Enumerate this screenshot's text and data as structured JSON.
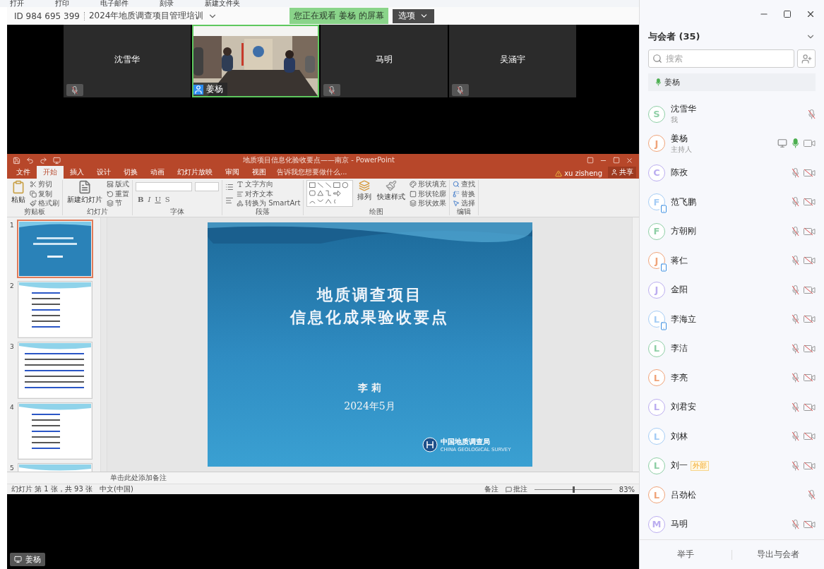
{
  "background_window": {
    "toolbar": [
      "打开",
      "打印",
      "电子邮件",
      "刻录",
      "新建文件夹"
    ]
  },
  "meeting": {
    "id": "ID 984 695 399",
    "title": "2024年地质调查项目管理培训",
    "banner": "您正在观看 姜杨 的屏幕",
    "options_button": "选项"
  },
  "video_tiles": [
    {
      "kind": "name",
      "name": "沈雪华",
      "muted": true
    },
    {
      "kind": "video",
      "name": "姜杨",
      "muted": false
    },
    {
      "kind": "name",
      "name": "马明",
      "muted": true
    },
    {
      "kind": "name",
      "name": "吴涵宇",
      "muted": true
    }
  ],
  "shared_screen": {
    "presenter_badge": "姜杨",
    "powerpoint": {
      "title": "地质项目信息化验收要点——南京 - PowerPoint",
      "tabs": [
        {
          "label": "文件",
          "selected": false
        },
        {
          "label": "开始",
          "selected": true
        },
        {
          "label": "插入",
          "selected": false
        },
        {
          "label": "设计",
          "selected": false
        },
        {
          "label": "切换",
          "selected": false
        },
        {
          "label": "动画",
          "selected": false
        },
        {
          "label": "幻灯片放映",
          "selected": false
        },
        {
          "label": "审阅",
          "selected": false
        },
        {
          "label": "视图",
          "selected": false
        }
      ],
      "tell_me": "告诉我您想要做什么...",
      "user": "xu zisheng",
      "share_button": "共享",
      "ribbon": {
        "clipboard": {
          "paste": "粘贴",
          "items": [
            "剪切",
            "复制",
            "格式刷"
          ],
          "label": "剪贴板"
        },
        "slides": {
          "new_slide": "新建幻灯片",
          "items": [
            "版式",
            "重置",
            "节"
          ],
          "label": "幻灯片"
        },
        "font": {
          "buttons": [
            "B",
            "I",
            "U",
            "S"
          ],
          "label": "字体"
        },
        "paragraph": {
          "items": [
            "文字方向",
            "对齐文本",
            "转换为 SmartArt"
          ],
          "label": "段落"
        },
        "drawing": {
          "arrange": "排列",
          "quick_styles": "快速样式",
          "items": [
            "形状填充",
            "形状轮廓",
            "形状效果"
          ],
          "label": "绘图"
        },
        "editing": {
          "items": [
            "查找",
            "替换",
            "选择"
          ],
          "label": "编辑"
        }
      },
      "thumbnails": [
        {
          "number": "1",
          "kind": "title",
          "selected": true
        },
        {
          "number": "2",
          "kind": "text",
          "selected": false
        },
        {
          "number": "3",
          "kind": "text",
          "selected": false
        },
        {
          "number": "4",
          "kind": "text",
          "selected": false
        },
        {
          "number": "5",
          "kind": "text",
          "selected": false
        }
      ],
      "slide": {
        "title_lines": [
          "地质调查项目",
          "信息化成果验收要点"
        ],
        "author": "李 莉",
        "date": "2024年5月",
        "logo_name": "中国地质调查局",
        "logo_english": "CHINA GEOLOGICAL SURVEY"
      },
      "notes_placeholder": "单击此处添加备注",
      "status_bar": {
        "slide_count": "幻灯片 第 1 张，共 93 张",
        "language": "中文(中国)",
        "notes": "备注",
        "comments": "批注",
        "zoom_slider": {
          "level": 0.5
        },
        "zoom": "83%"
      }
    }
  },
  "participants_panel": {
    "title": "与会者 (35)",
    "search": {
      "placeholder": "搜索"
    },
    "speaking": "姜杨",
    "participants": [
      {
        "name": "沈雪华",
        "subtitle": "我",
        "initial": "S",
        "color": "#8fcfa6",
        "muted": true,
        "mobile": false,
        "sharing": false
      },
      {
        "name": "姜杨",
        "subtitle": "主持人",
        "initial": "J",
        "color": "#f0a47a",
        "muted": false,
        "camera_off": false,
        "mobile": false,
        "sharing": true
      },
      {
        "name": "陈孜",
        "initial": "C",
        "color": "#bcaef0",
        "muted": true,
        "camera_off": true,
        "mobile": false,
        "sharing": false
      },
      {
        "name": "范飞鹏",
        "initial": "F",
        "color": "#a6cdf5",
        "muted": true,
        "camera_off": true,
        "mobile": true,
        "sharing": false
      },
      {
        "name": "方朝刚",
        "initial": "F",
        "color": "#8fcfa6",
        "muted": true,
        "camera_off": true,
        "mobile": false,
        "sharing": false
      },
      {
        "name": "蒋仁",
        "initial": "J",
        "color": "#f0a47a",
        "muted": true,
        "camera_off": true,
        "mobile": true,
        "sharing": false
      },
      {
        "name": "金阳",
        "initial": "J",
        "color": "#bcaef0",
        "muted": true,
        "camera_off": true,
        "mobile": false,
        "sharing": false
      },
      {
        "name": "李海立",
        "initial": "L",
        "color": "#a6cdf5",
        "muted": true,
        "camera_off": true,
        "mobile": true,
        "sharing": false
      },
      {
        "name": "李洁",
        "initial": "L",
        "color": "#8fcfa6",
        "muted": true,
        "camera_off": true,
        "mobile": false,
        "sharing": false
      },
      {
        "name": "李亮",
        "initial": "L",
        "color": "#f0a47a",
        "muted": true,
        "camera_off": true,
        "mobile": false,
        "sharing": false
      },
      {
        "name": "刘君安",
        "initial": "L",
        "color": "#bcaef0",
        "muted": true,
        "camera_off": true,
        "mobile": false,
        "sharing": false
      },
      {
        "name": "刘林",
        "initial": "L",
        "color": "#a6cdf5",
        "muted": true,
        "camera_off": true,
        "mobile": false,
        "sharing": false
      },
      {
        "name": "刘一",
        "tag": "外部",
        "initial": "L",
        "color": "#8fcfa6",
        "muted": true,
        "camera_off": true,
        "mobile": false,
        "sharing": false
      },
      {
        "name": "吕劲松",
        "initial": "L",
        "color": "#f0a47a",
        "muted": true,
        "mobile": false,
        "sharing": false
      },
      {
        "name": "马明",
        "initial": "M",
        "color": "#bcaef0",
        "muted": true,
        "camera_off": true,
        "mobile": false,
        "sharing": false
      }
    ],
    "footer_buttons": [
      "举手",
      "导出与会者"
    ]
  }
}
